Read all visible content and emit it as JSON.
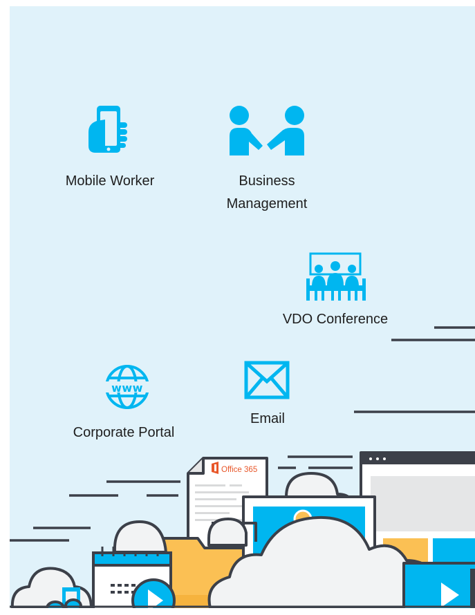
{
  "features": {
    "mobile_worker": {
      "label": "Mobile Worker",
      "icon": "mobile-hand-icon"
    },
    "business_management": {
      "line1": "Business",
      "line2": "Management",
      "icon": "handshake-icon"
    },
    "vdo_conference": {
      "label": "VDO Conference",
      "icon": "conference-meeting-icon"
    },
    "corporate_portal": {
      "label": "Corporate Portal",
      "icon": "www-globe-icon"
    },
    "email": {
      "label": "Email",
      "icon": "envelope-icon"
    }
  },
  "illustration": {
    "document_title": "Office 365",
    "icons": [
      "office-logo-icon",
      "music-note-icon",
      "calendar-icon",
      "play-icon",
      "folder-icon",
      "image-icon",
      "cloud-icon",
      "browser-window-icon"
    ]
  },
  "colors": {
    "background": "#e0f2fa",
    "accent": "#00b6f0",
    "outline": "#3c4049",
    "office_orange": "#e8572a",
    "folder_yellow": "#fbc054",
    "cloud_gray": "#f2f3f4"
  }
}
